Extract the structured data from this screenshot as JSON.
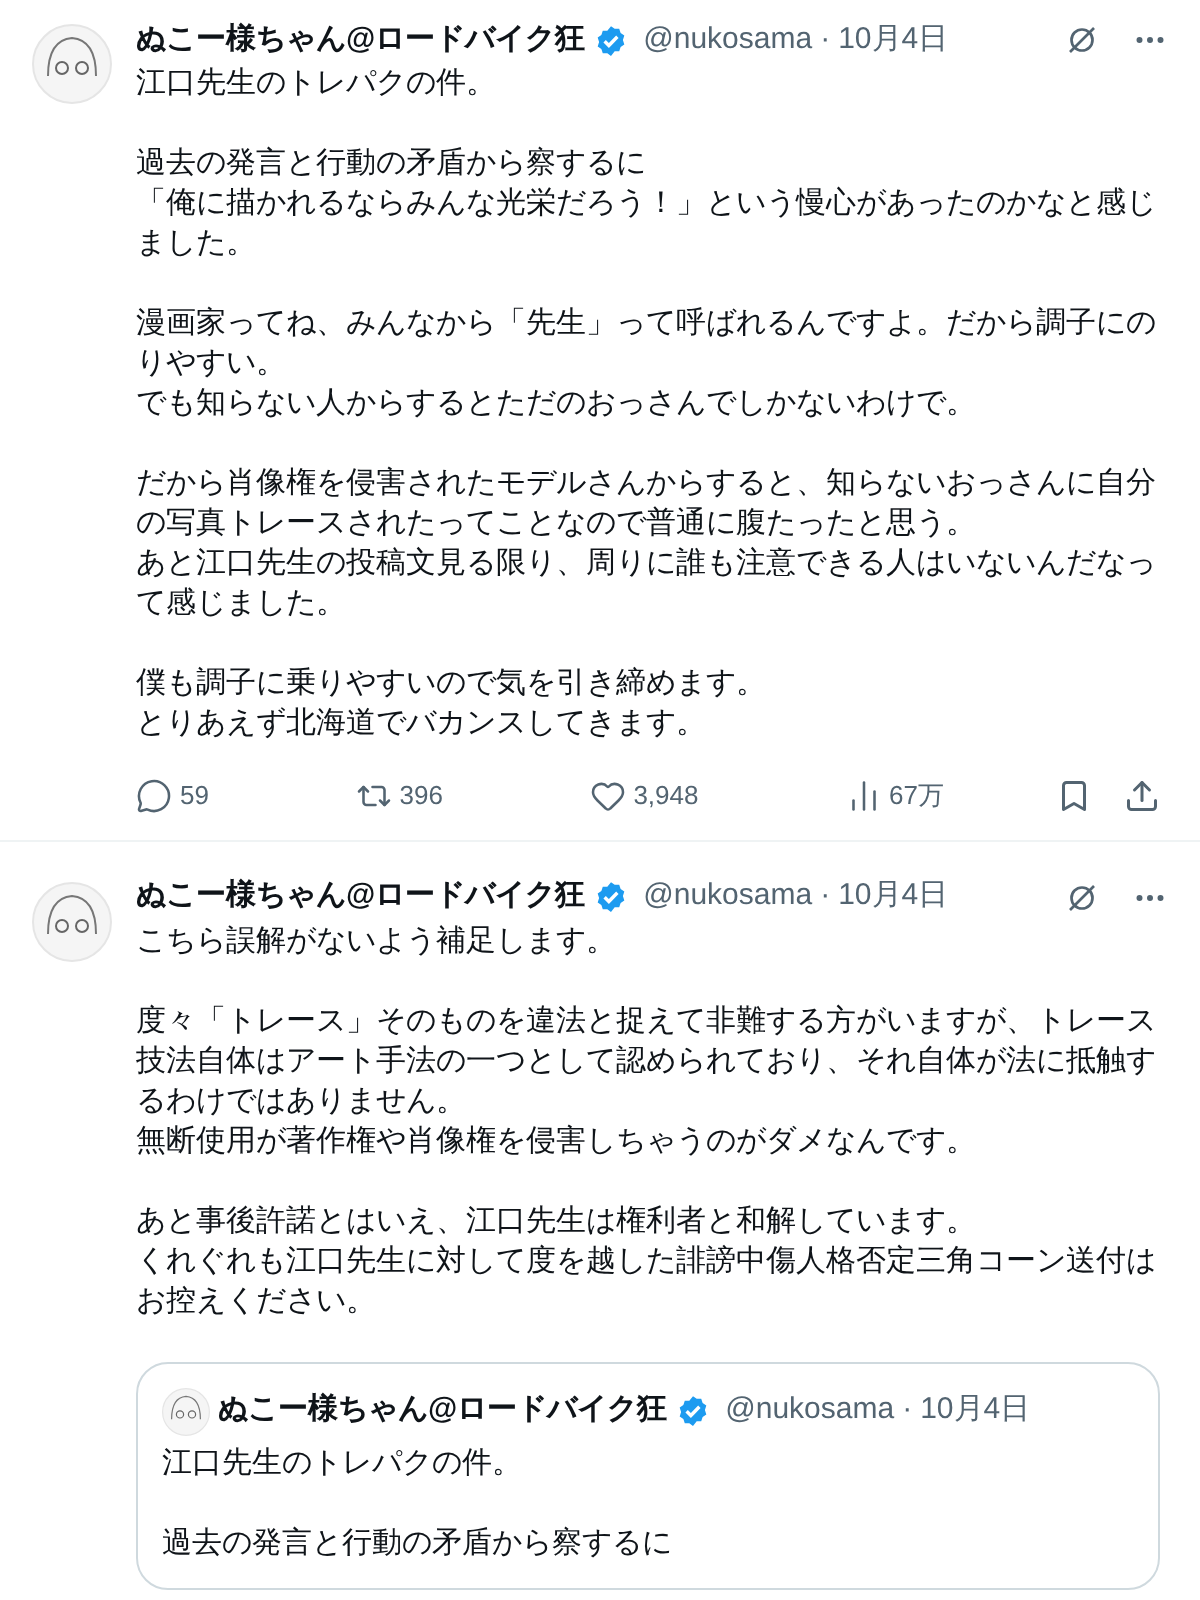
{
  "tweets": [
    {
      "author": {
        "name": "ぬこー様ちゃん@ロードバイク狂",
        "verified": true,
        "handle": "@nukosama",
        "separator": "·",
        "date": "10月4日"
      },
      "body": [
        [
          "江口先生のトレパクの件。"
        ],
        [
          "過去の発言と行動の矛盾から察するに",
          "「俺に描かれるならみんな光栄だろう！」という慢心があったのかなと感じました。"
        ],
        [
          "漫画家ってね、みんなから「先生」って呼ばれるんですよ。だから調子にのりやすい。",
          "でも知らない人からするとただのおっさんでしかないわけで。"
        ],
        [
          "だから肖像権を侵害されたモデルさんからすると、知らないおっさんに自分の写真トレースされたってことなので普通に腹たったと思う。",
          "あと江口先生の投稿文見る限り、周りに誰も注意できる人はいないんだなって感じました。"
        ],
        [
          "僕も調子に乗りやすいので気を引き締めます。",
          "とりあえず北海道でバカンスしてきます。"
        ]
      ],
      "stats": {
        "replies": "59",
        "reposts": "396",
        "likes": "3,948",
        "views": "67万"
      }
    },
    {
      "author": {
        "name": "ぬこー様ちゃん@ロードバイク狂",
        "verified": true,
        "handle": "@nukosama",
        "separator": "·",
        "date": "10月4日"
      },
      "body": [
        [
          "こちら誤解がないよう補足します。"
        ],
        [
          "度々「トレース」そのものを違法と捉えて非難する方がいますが、トレース技法自体はアート手法の一つとして認められており、それ自体が法に抵触するわけではありません。",
          "無断使用が著作権や肖像権を侵害しちゃうのがダメなんです。"
        ],
        [
          "あと事後許諾とはいえ、江口先生は権利者と和解しています。",
          "くれぐれも江口先生に対して度を越した誹謗中傷人格否定三角コーン送付はお控えください。"
        ]
      ],
      "quote": {
        "author": {
          "name": "ぬこー様ちゃん@ロードバイク狂",
          "verified": true,
          "handle": "@nukosama",
          "separator": "·",
          "date": "10月4日"
        },
        "body": [
          [
            "江口先生のトレパクの件。"
          ],
          [
            "過去の発言と行動の矛盾から察するに"
          ]
        ]
      }
    }
  ]
}
